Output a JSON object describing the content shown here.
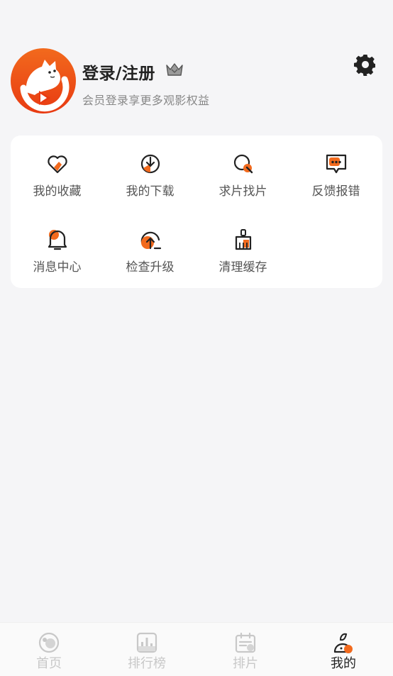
{
  "profile": {
    "login_label": "登录/注册",
    "subtitle": "会员登录享更多观影权益",
    "avatar_icon": "cat-logo-icon",
    "vip_icon": "crown-icon",
    "settings_icon": "gear-icon"
  },
  "menu": {
    "items": [
      {
        "label": "我的收藏",
        "icon": "heart-icon"
      },
      {
        "label": "我的下载",
        "icon": "download-icon"
      },
      {
        "label": "求片找片",
        "icon": "search-icon"
      },
      {
        "label": "反馈报错",
        "icon": "feedback-icon"
      },
      {
        "label": "消息中心",
        "icon": "bell-icon"
      },
      {
        "label": "检查升级",
        "icon": "upgrade-icon"
      },
      {
        "label": "清理缓存",
        "icon": "broom-icon"
      }
    ]
  },
  "nav": {
    "items": [
      {
        "label": "首页",
        "icon": "home-icon",
        "active": false
      },
      {
        "label": "排行榜",
        "icon": "ranking-icon",
        "active": false
      },
      {
        "label": "排片",
        "icon": "calendar-icon",
        "active": false
      },
      {
        "label": "我的",
        "icon": "profile-icon",
        "active": true
      }
    ]
  },
  "colors": {
    "accent": "#f26a1d",
    "accent_dark": "#e83a12",
    "text_primary": "#222222",
    "text_secondary": "#888888",
    "nav_inactive": "#c8c8c8",
    "background": "#f5f5f7"
  }
}
